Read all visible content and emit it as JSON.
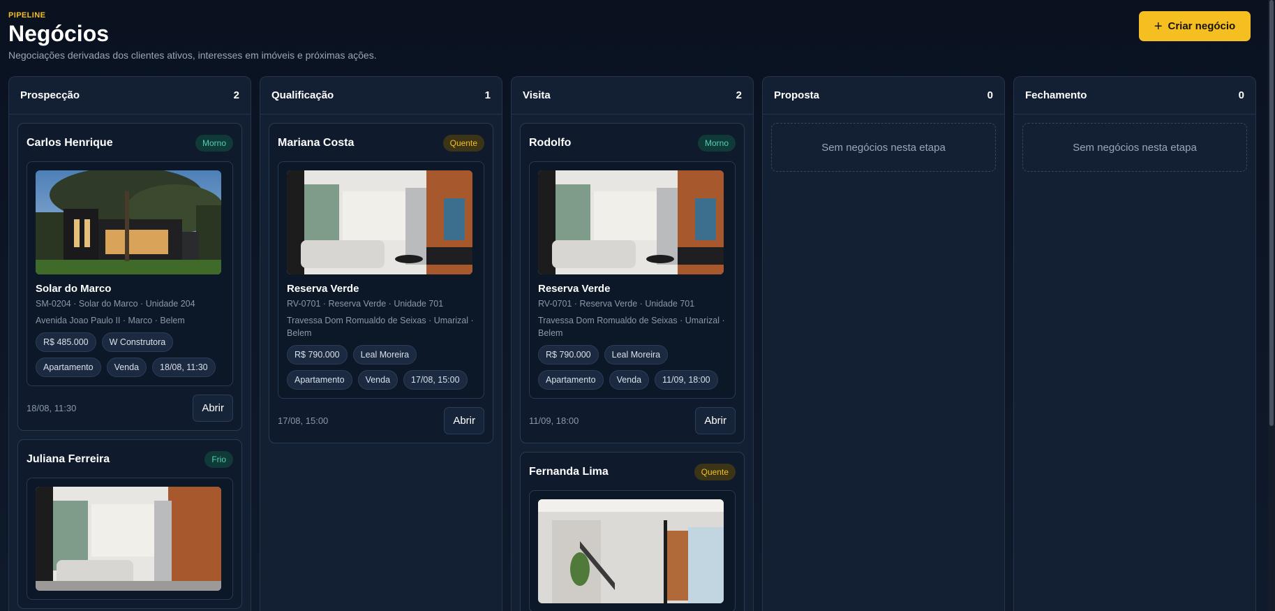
{
  "header": {
    "eyebrow": "PIPELINE",
    "title": "Negócios",
    "subtitle": "Negociações derivadas dos clientes ativos, interesses em imóveis e próximas ações.",
    "create_label": "Criar negócio"
  },
  "colors": {
    "accent": "#f5bf22",
    "warm_badge": "#4fd1b0",
    "hot_badge": "#f5bf22"
  },
  "columns": [
    {
      "title": "Prospecção",
      "count": "2"
    },
    {
      "title": "Qualificação",
      "count": "1"
    },
    {
      "title": "Visita",
      "count": "2"
    },
    {
      "title": "Proposta",
      "count": "0",
      "empty": "Sem negócios nesta etapa"
    },
    {
      "title": "Fechamento",
      "count": "0",
      "empty": "Sem negócios nesta etapa"
    }
  ],
  "deals": {
    "carlos": {
      "name": "Carlos Henrique",
      "badge": "Morno",
      "prop": "Solar do Marco",
      "code": "SM-0204 · Solar do Marco · Unidade 204",
      "addr": "Avenida Joao Paulo II · Marco · Belem",
      "price": "R$ 485.000",
      "builder": "W Construtora",
      "type": "Apartamento",
      "mode": "Venda",
      "date_chip": "18/08, 11:30",
      "date": "18/08, 11:30",
      "open": "Abrir"
    },
    "juliana": {
      "name": "Juliana Ferreira",
      "badge": "Frio"
    },
    "mariana": {
      "name": "Mariana Costa",
      "badge": "Quente",
      "prop": "Reserva Verde",
      "code": "RV-0701 · Reserva Verde · Unidade 701",
      "addr": "Travessa Dom Romualdo de Seixas · Umarizal · Belem",
      "price": "R$ 790.000",
      "builder": "Leal Moreira",
      "type": "Apartamento",
      "mode": "Venda",
      "date_chip": "17/08, 15:00",
      "date": "17/08, 15:00",
      "open": "Abrir"
    },
    "rodolfo": {
      "name": "Rodolfo",
      "badge": "Morno",
      "prop": "Reserva Verde",
      "code": "RV-0701 · Reserva Verde · Unidade 701",
      "addr": "Travessa Dom Romualdo de Seixas · Umarizal · Belem",
      "price": "R$ 790.000",
      "builder": "Leal Moreira",
      "type": "Apartamento",
      "mode": "Venda",
      "date_chip": "11/09, 18:00",
      "date": "11/09, 18:00",
      "open": "Abrir"
    },
    "fernanda": {
      "name": "Fernanda Lima",
      "badge": "Quente"
    }
  }
}
